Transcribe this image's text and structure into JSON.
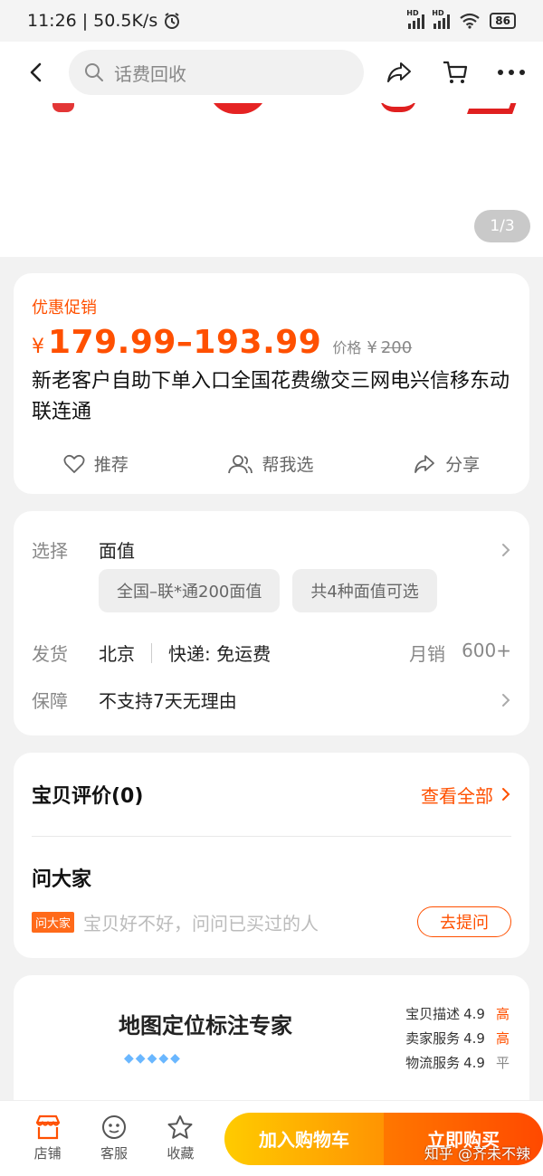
{
  "status": {
    "time": "11:26",
    "net": "50.5K/s",
    "hd": "HD",
    "battery": "86"
  },
  "nav": {
    "search_placeholder": "话费回收"
  },
  "hero": {
    "counter": "1/3"
  },
  "product": {
    "promo_label": "优惠促销",
    "currency": "¥",
    "price_range": "179.99–193.99",
    "orig_label": "价格",
    "orig_currency": "¥",
    "orig_price": "200",
    "title": "新老客户自助下单入口全国花费缴交三网电兴信移东动联连通",
    "actions": {
      "recommend": "推荐",
      "help_choose": "帮我选",
      "share": "分享"
    }
  },
  "options": {
    "select_key": "选择",
    "select_val": "面值",
    "chips": [
      "全国–联*通200面值",
      "共4种面值可选"
    ],
    "ship_key": "发货",
    "ship_from": "北京",
    "ship_method": "快递: 免运费",
    "sales_label": "月销",
    "sales_value": "600+",
    "guarantee_key": "保障",
    "guarantee_val": "不支持7天无理由"
  },
  "reviews": {
    "title": "宝贝评价(0)",
    "view_all": "查看全部",
    "ask_title": "问大家",
    "ask_tag": "问大家",
    "ask_hint": "宝贝好不好，问问已买过的人",
    "ask_button": "去提问"
  },
  "shop": {
    "name": "地图定位标注专家",
    "scores": [
      {
        "label": "宝贝描述",
        "value": "4.9",
        "level": "高"
      },
      {
        "label": "卖家服务",
        "value": "4.9",
        "level": "高"
      },
      {
        "label": "物流服务",
        "value": "4.9",
        "level": "平"
      }
    ]
  },
  "bottom": {
    "shop": "店铺",
    "service": "客服",
    "favorite": "收藏",
    "add_cart": "加入购物车",
    "buy_now": "立即购买"
  },
  "watermark": "知乎 @齐未不辣",
  "colors": {
    "accent": "#ff5000",
    "cart_btn": "#ffb000",
    "buy_btn": "#ff5a00"
  }
}
